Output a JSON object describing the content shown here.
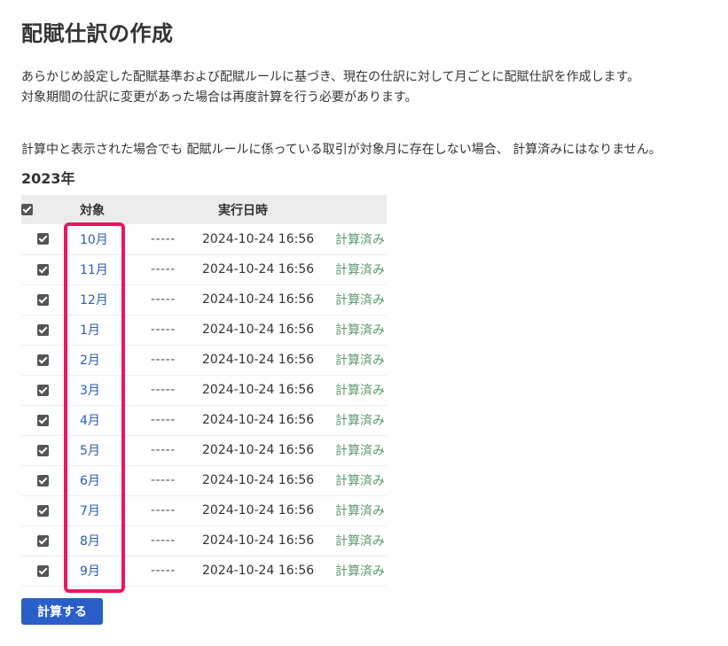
{
  "page": {
    "title": "配賦仕訳の作成",
    "description_line1": "あらかじめ設定した配賦基準および配賦ルールに基づき、現在の仕訳に対して月ごとに配賦仕訳を作成します。",
    "description_line2": "対象期間の仕訳に変更があった場合は再度計算を行う必要があります。",
    "note": "計算中と表示された場合でも 配賦ルールに係っている取引が対象月に存在しない場合、 計算済みにはなりません。",
    "year_label": "2023年"
  },
  "table": {
    "headers": {
      "target": "対象",
      "executed_at": "実行日時"
    },
    "select_all_checked": true,
    "rows": [
      {
        "month": "10月",
        "dash": "-----",
        "executed_at": "2024-10-24 16:56",
        "status": "計算済み",
        "checked": true
      },
      {
        "month": "11月",
        "dash": "-----",
        "executed_at": "2024-10-24 16:56",
        "status": "計算済み",
        "checked": true
      },
      {
        "month": "12月",
        "dash": "-----",
        "executed_at": "2024-10-24 16:56",
        "status": "計算済み",
        "checked": true
      },
      {
        "month": "1月",
        "dash": "-----",
        "executed_at": "2024-10-24 16:56",
        "status": "計算済み",
        "checked": true
      },
      {
        "month": "2月",
        "dash": "-----",
        "executed_at": "2024-10-24 16:56",
        "status": "計算済み",
        "checked": true
      },
      {
        "month": "3月",
        "dash": "-----",
        "executed_at": "2024-10-24 16:56",
        "status": "計算済み",
        "checked": true
      },
      {
        "month": "4月",
        "dash": "-----",
        "executed_at": "2024-10-24 16:56",
        "status": "計算済み",
        "checked": true
      },
      {
        "month": "5月",
        "dash": "-----",
        "executed_at": "2024-10-24 16:56",
        "status": "計算済み",
        "checked": true
      },
      {
        "month": "6月",
        "dash": "-----",
        "executed_at": "2024-10-24 16:56",
        "status": "計算済み",
        "checked": true
      },
      {
        "month": "7月",
        "dash": "-----",
        "executed_at": "2024-10-24 16:56",
        "status": "計算済み",
        "checked": true
      },
      {
        "month": "8月",
        "dash": "-----",
        "executed_at": "2024-10-24 16:56",
        "status": "計算済み",
        "checked": true
      },
      {
        "month": "9月",
        "dash": "-----",
        "executed_at": "2024-10-24 16:56",
        "status": "計算済み",
        "checked": true
      }
    ]
  },
  "actions": {
    "calculate_label": "計算する"
  },
  "colors": {
    "accent_button": "#2a5ec8",
    "link": "#2a5db0",
    "status_done": "#5a9a6a",
    "highlight": "#f0145f",
    "header_bg": "#ececec"
  }
}
